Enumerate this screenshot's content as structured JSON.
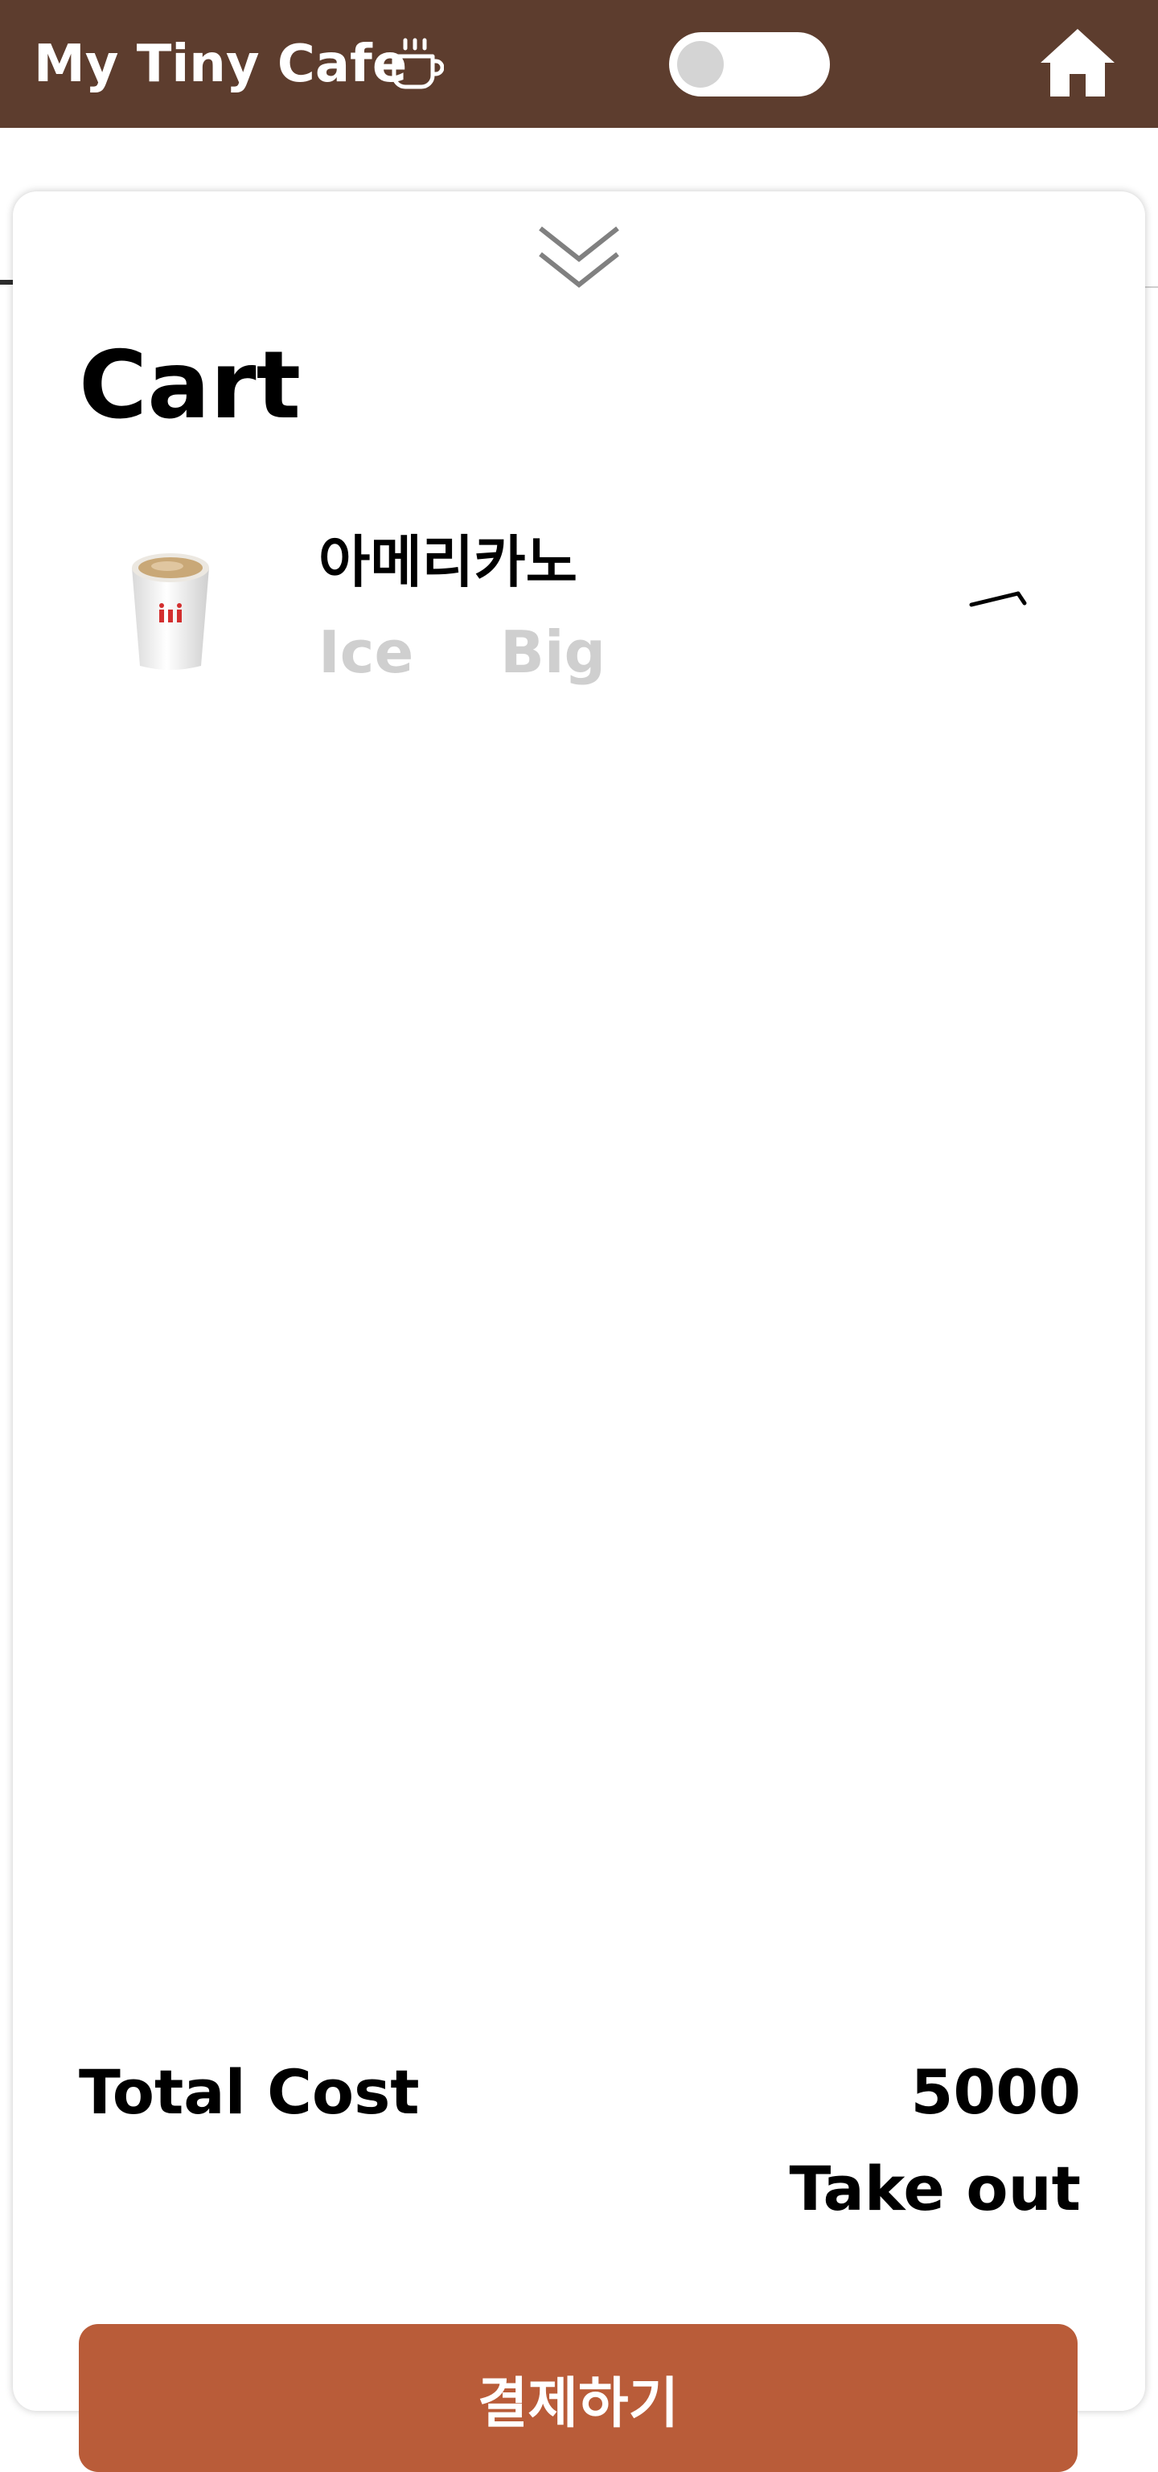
{
  "appbar": {
    "title": "My Tiny Cafe",
    "title_icon": "coffee-cup-icon",
    "toggle_on": false,
    "home_icon": "home-icon",
    "background_color": "#5d3d2e"
  },
  "cart": {
    "collapse_icon": "double-chevron-down-icon",
    "title": "Cart",
    "items": [
      {
        "name": "아메리카노",
        "temperature": "Ice",
        "size": "Big",
        "thumbnail_icon": "coffee-cup-image",
        "action_icon": "swipe-arrow-icon"
      }
    ],
    "total_label": "Total Cost",
    "total_value": "5000",
    "order_type": "Take out",
    "pay_button_label": "결제하기",
    "pay_button_color": "#b95c39"
  }
}
